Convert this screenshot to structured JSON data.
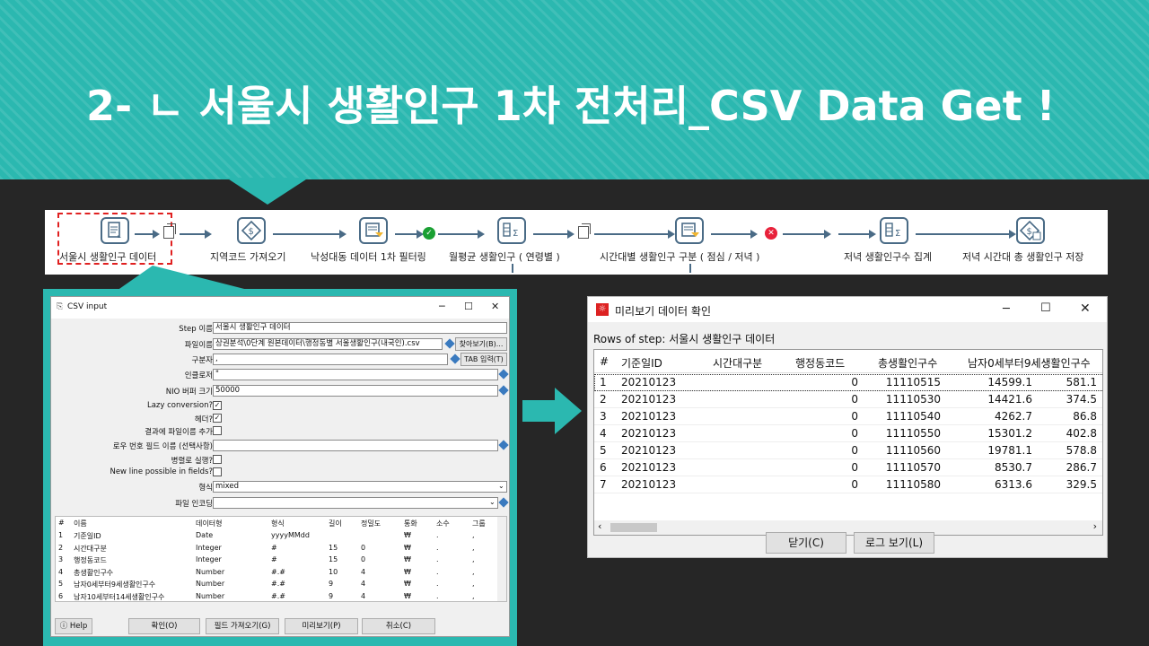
{
  "slide": {
    "title": "2- ㄴ 서울시 생활인구 1차 전처리_CSV Data Get !"
  },
  "colors": {
    "accent": "#2bb8b0",
    "background": "#262626",
    "selection": "#e02020",
    "ok": "#1aa033",
    "error": "#e8213a"
  },
  "flow": {
    "steps": [
      {
        "label": "서울시 생활인구 데이터",
        "icon": "csv-input-icon"
      },
      {
        "label": "지역코드 가져오기",
        "icon": "lookup-icon"
      },
      {
        "label": "낙성대동 데이터 1차 필터링",
        "icon": "filter-icon"
      },
      {
        "label": "월평균 생활인구 ( 연령별 )",
        "icon": "group-by-icon"
      },
      {
        "label": "시간대별 생활인구 구분 ( 점심 / 저녁 )",
        "icon": "filter-icon"
      },
      {
        "label": "저녁 생활인구수 집계",
        "icon": "group-by-icon"
      },
      {
        "label": "저녁 시간대 총 생활인구 저장",
        "icon": "output-icon"
      }
    ]
  },
  "csv_dialog": {
    "title": "CSV input",
    "fields": {
      "step_name_label": "Step 이름",
      "step_name": "서울시 생활인구 데이터",
      "filename_label": "파일이름",
      "filename": "상권분석\\0단계 원본데이터\\행정동별 서울생활인구(내국인).csv",
      "browse": "찾아보기(B)...",
      "delimiter_label": "구분자",
      "delimiter": ",",
      "tab_insert": "TAB 입력(T)",
      "enclosure_label": "인클로저",
      "enclosure": "\"",
      "nio_label": "NIO 버퍼 크기",
      "nio": "50000",
      "lazy_label": "Lazy conversion?",
      "header_label": "헤더?",
      "add_filename_label": "결과에 파일이름 추가",
      "row_num_label": "로우 번호 필드 이름 (선택사항)",
      "parallel_label": "병렬로 실행?",
      "newline_label": "New line possible in fields?",
      "format_label": "형식",
      "format": "mixed",
      "encoding_label": "파일 인코딩",
      "encoding": ""
    },
    "checks": {
      "lazy": "✓",
      "header": "✓",
      "add_filename": "",
      "parallel": "",
      "newline": ""
    },
    "grid": {
      "headers": [
        "#",
        "이름",
        "데이터형",
        "형식",
        "길이",
        "정밀도",
        "통화",
        "소수",
        "그룹"
      ],
      "rows": [
        [
          "1",
          "기준일ID",
          "Date",
          "yyyyMMdd",
          "",
          "",
          "₩",
          ".",
          ","
        ],
        [
          "2",
          "시간대구분",
          "Integer",
          "#",
          "15",
          "0",
          "₩",
          ".",
          ","
        ],
        [
          "3",
          "행정동코드",
          "Integer",
          "#",
          "15",
          "0",
          "₩",
          ".",
          ","
        ],
        [
          "4",
          "총생활인구수",
          "Number",
          "#.#",
          "10",
          "4",
          "₩",
          ".",
          ","
        ],
        [
          "5",
          "남자0세부터9세생활인구수",
          "Number",
          "#.#",
          "9",
          "4",
          "₩",
          ".",
          ","
        ],
        [
          "6",
          "남자10세부터14세생활인구수",
          "Number",
          "#.#",
          "9",
          "4",
          "₩",
          ".",
          ","
        ]
      ]
    },
    "buttons": {
      "help": "Help",
      "ok": "확인(O)",
      "get_fields": "필드 가져오기(G)",
      "preview": "미리보기(P)",
      "cancel": "취소(C)"
    }
  },
  "preview_dialog": {
    "title": "미리보기 데이터 확인",
    "subtitle": "Rows of step: 서울시 생활인구 데이터",
    "headers": [
      "#",
      "기준일ID",
      "시간대구분",
      "행정동코드",
      "총생활인구수",
      "남자0세부터9세생활인구수"
    ],
    "rows": [
      [
        "1",
        "20210123",
        "0",
        "11110515",
        "14599.1",
        "581.1"
      ],
      [
        "2",
        "20210123",
        "0",
        "11110530",
        "14421.6",
        "374.5"
      ],
      [
        "3",
        "20210123",
        "0",
        "11110540",
        "4262.7",
        "86.8"
      ],
      [
        "4",
        "20210123",
        "0",
        "11110550",
        "15301.2",
        "402.8"
      ],
      [
        "5",
        "20210123",
        "0",
        "11110560",
        "19781.1",
        "578.8"
      ],
      [
        "6",
        "20210123",
        "0",
        "11110570",
        "8530.7",
        "286.7"
      ],
      [
        "7",
        "20210123",
        "0",
        "11110580",
        "6313.6",
        "329.5"
      ]
    ],
    "buttons": {
      "close": "닫기(C)",
      "log": "로그 보기(L)"
    }
  }
}
